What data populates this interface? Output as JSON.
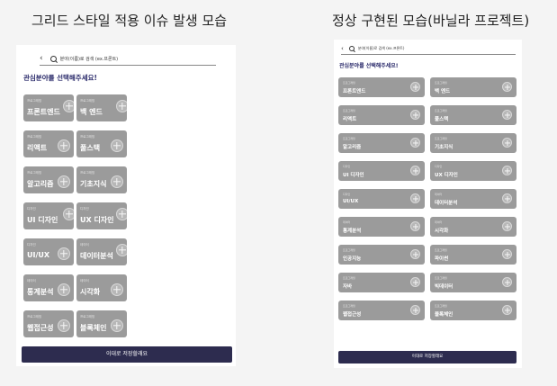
{
  "titles": {
    "left": "그리드 스타일 적용 이슈 발생 모습",
    "right": "정상 구현된 모습(바닐라 프로젝트)"
  },
  "search": {
    "placeholder": "분야(이름)로 검색 (ex.프론트)"
  },
  "heading": "관심분야를 선택해주세요!",
  "save_button": "이대로 저장할래요",
  "left_cards": [
    {
      "category": "프로그래밍",
      "name": "프론트엔드"
    },
    {
      "category": "프로그래밍",
      "name": "백 엔드"
    },
    {
      "category": "프로그래밍",
      "name": "리액트"
    },
    {
      "category": "프로그래밍",
      "name": "풀스택"
    },
    {
      "category": "프로그래밍",
      "name": "알고리즘"
    },
    {
      "category": "프로그래밍",
      "name": "기초지식"
    },
    {
      "category": "디자인",
      "name": "UI 디자인"
    },
    {
      "category": "디자인",
      "name": "UX 디자인"
    },
    {
      "category": "디자인",
      "name": "UI/UX"
    },
    {
      "category": "데이터",
      "name": "데이터분석"
    },
    {
      "category": "데이터",
      "name": "통계분석"
    },
    {
      "category": "데이터",
      "name": "시각화"
    },
    {
      "category": "프로그래밍",
      "name": "웹접근성"
    },
    {
      "category": "프로그래밍",
      "name": "블록체인"
    }
  ],
  "right_cards": [
    {
      "category": "프로그래밍",
      "name": "프론트엔드"
    },
    {
      "category": "프로그래밍",
      "name": "백 엔드"
    },
    {
      "category": "프로그래밍",
      "name": "리액트"
    },
    {
      "category": "프로그래밍",
      "name": "풀스택"
    },
    {
      "category": "프로그래밍",
      "name": "알고리즘"
    },
    {
      "category": "프로그래밍",
      "name": "기초지식"
    },
    {
      "category": "디자인",
      "name": "UI 디자인"
    },
    {
      "category": "디자인",
      "name": "UX 디자인"
    },
    {
      "category": "디자인",
      "name": "UI/UX"
    },
    {
      "category": "데이터",
      "name": "데이터분석"
    },
    {
      "category": "데이터",
      "name": "통계분석"
    },
    {
      "category": "데이터",
      "name": "시각화"
    },
    {
      "category": "프로그래밍",
      "name": "인공지능"
    },
    {
      "category": "프로그래밍",
      "name": "파이썬"
    },
    {
      "category": "프로그래밍",
      "name": "자바"
    },
    {
      "category": "프로그래밍",
      "name": "빅데이터"
    },
    {
      "category": "프로그래밍",
      "name": "웹접근성"
    },
    {
      "category": "프로그래밍",
      "name": "블록체인"
    }
  ],
  "colors": {
    "card_background": "#9b9b9b",
    "button_background": "#2d2c4f",
    "heading_text": "#2a2a6a"
  }
}
